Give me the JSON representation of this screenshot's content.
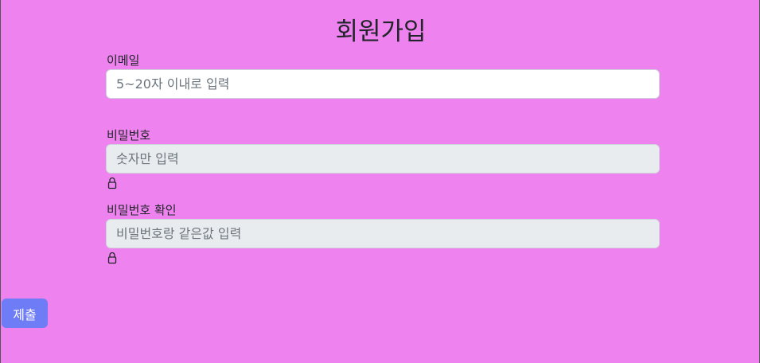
{
  "page": {
    "title": "회원가입"
  },
  "form": {
    "email": {
      "label": "이메일",
      "placeholder": "5~20자 이내로 입력"
    },
    "password": {
      "label": "비밀번호",
      "placeholder": "숫자만 입력",
      "icon": "lock-icon"
    },
    "password_confirm": {
      "label": "비밀번호 확인",
      "placeholder": "비밀번호랑 같은값 입력",
      "icon": "lock-icon"
    },
    "submit_label": "제출"
  },
  "colors": {
    "background": "#ee82ee",
    "submit_button": "#6e7cf6",
    "disabled_input": "#e9ecef"
  }
}
